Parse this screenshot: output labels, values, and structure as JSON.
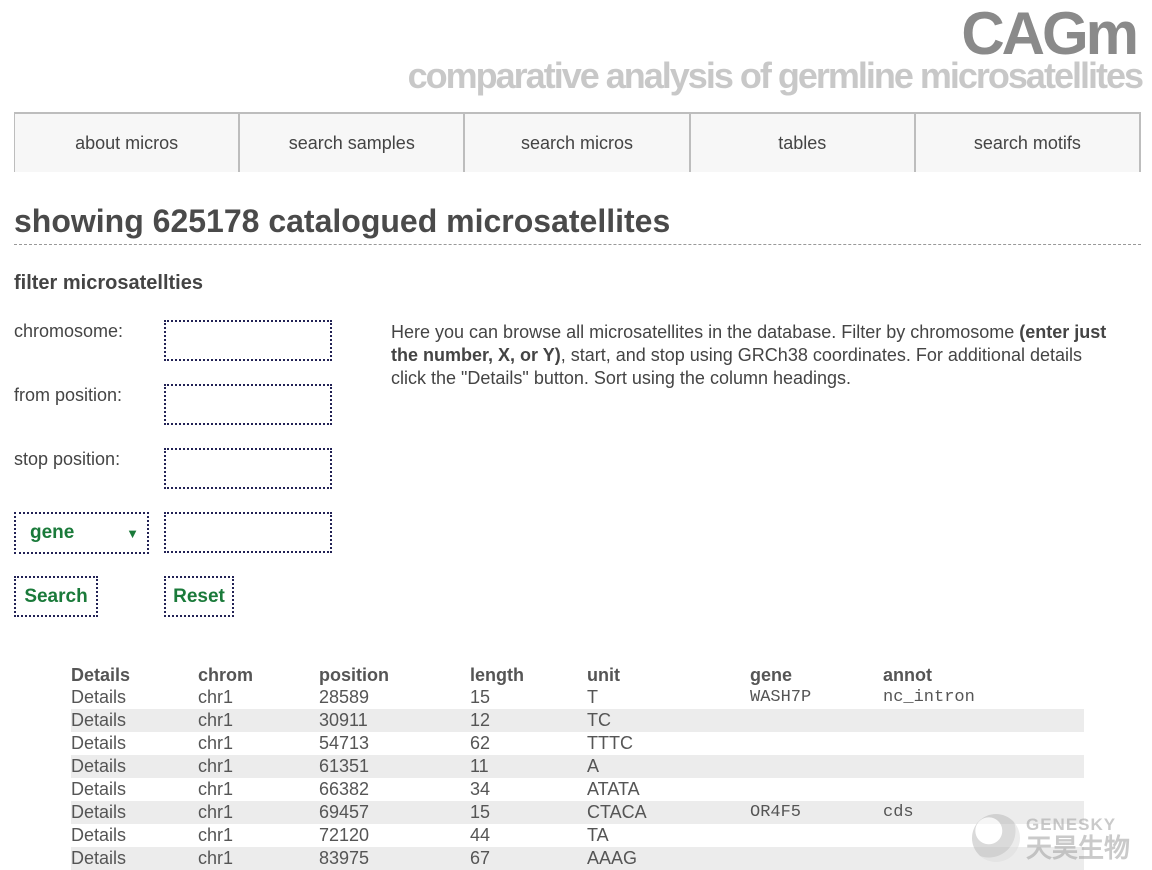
{
  "brand": {
    "title": "CAGm",
    "subtitle": "comparative analysis of germline microsatellites"
  },
  "nav": {
    "items": [
      {
        "label": "about micros"
      },
      {
        "label": "search samples"
      },
      {
        "label": "search micros"
      },
      {
        "label": "tables"
      },
      {
        "label": "search motifs"
      }
    ]
  },
  "page": {
    "title": "showing 625178 catalogued microsatellites"
  },
  "filter": {
    "heading": "filter microsatellties",
    "chromosome_label": "chromosome:",
    "from_label": "from position:",
    "stop_label": "stop position:",
    "chromosome_value": "",
    "from_value": "",
    "stop_value": "",
    "select_value": "gene",
    "select_text_value": "",
    "search_button": "Search",
    "reset_button": "Reset"
  },
  "help": {
    "part1": "Here you can browse all microsatellites in the database. Filter by chromosome ",
    "bold": "(enter just the number, X, or Y)",
    "part2": ", start, and stop using GRCh38 coordinates. For additional details click the \"Details\" button. Sort using the column headings."
  },
  "table": {
    "headers": {
      "details": "Details",
      "chrom": "chrom",
      "position": "position",
      "length": "length",
      "unit": "unit",
      "gene": "gene",
      "annot": "annot"
    },
    "rows": [
      {
        "details": "Details",
        "chrom": "chr1",
        "position": "28589",
        "length": "15",
        "unit": "T",
        "gene": "WASH7P",
        "annot": "nc_intron"
      },
      {
        "details": "Details",
        "chrom": "chr1",
        "position": "30911",
        "length": "12",
        "unit": "TC",
        "gene": "",
        "annot": ""
      },
      {
        "details": "Details",
        "chrom": "chr1",
        "position": "54713",
        "length": "62",
        "unit": "TTTC",
        "gene": "",
        "annot": ""
      },
      {
        "details": "Details",
        "chrom": "chr1",
        "position": "61351",
        "length": "11",
        "unit": "A",
        "gene": "",
        "annot": ""
      },
      {
        "details": "Details",
        "chrom": "chr1",
        "position": "66382",
        "length": "34",
        "unit": "ATATA",
        "gene": "",
        "annot": ""
      },
      {
        "details": "Details",
        "chrom": "chr1",
        "position": "69457",
        "length": "15",
        "unit": "CTACA",
        "gene": "OR4F5",
        "annot": "cds"
      },
      {
        "details": "Details",
        "chrom": "chr1",
        "position": "72120",
        "length": "44",
        "unit": "TA",
        "gene": "",
        "annot": ""
      },
      {
        "details": "Details",
        "chrom": "chr1",
        "position": "83975",
        "length": "67",
        "unit": "AAAG",
        "gene": "",
        "annot": ""
      }
    ]
  },
  "watermark": {
    "en": "GENESKY",
    "cn": "天昊生物"
  }
}
